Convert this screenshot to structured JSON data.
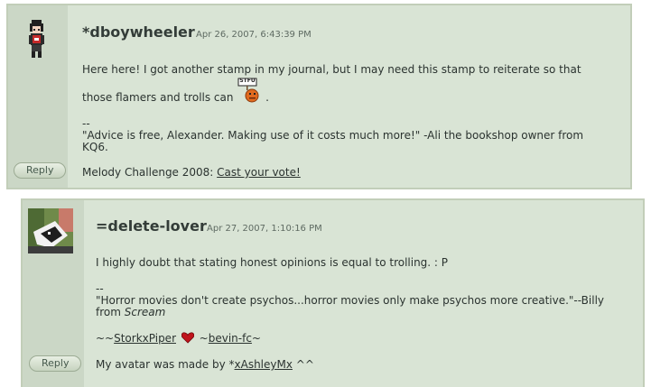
{
  "comments": [
    {
      "author": "*dboywheeler",
      "timestamp": "Apr 26, 2007, 6:43:39 PM",
      "reply_label": "Reply",
      "line1": "Here here! I got another stamp in my journal, but I may need this stamp to reiterate so that",
      "line2_prefix": "those flamers and trolls can",
      "line2_suffix": ".",
      "stamp_text": "STFU",
      "sig_dash": "--",
      "sig_quote_1": "\"Advice is free, Alexander. Making use of it costs much more!\" -Ali the bookshop owner from",
      "sig_quote_2": "KQ6.",
      "melody_prefix": "Melody Challenge 2008: ",
      "melody_link": "Cast your vote!"
    },
    {
      "author": "=delete-lover",
      "timestamp": "Apr 27, 2007, 1:10:16 PM",
      "reply_label": "Reply",
      "line1": "I highly doubt that stating honest opinions is equal to trolling. : P",
      "sig_dash": "--",
      "sig_quote_1": "\"Horror movies don't create psychos...horror movies only make psychos more creative.\"--Billy",
      "sig_quote_2_prefix": "from ",
      "sig_quote_2_em": "Scream",
      "tilde1": "~~",
      "link1": "StorkxPiper",
      "tilde2": "~",
      "link2": "bevin-fc",
      "tilde3": "~",
      "avatar_prefix": "My avatar was made by *",
      "avatar_link": "xAshleyMx",
      "avatar_suffix": " ^^"
    }
  ]
}
